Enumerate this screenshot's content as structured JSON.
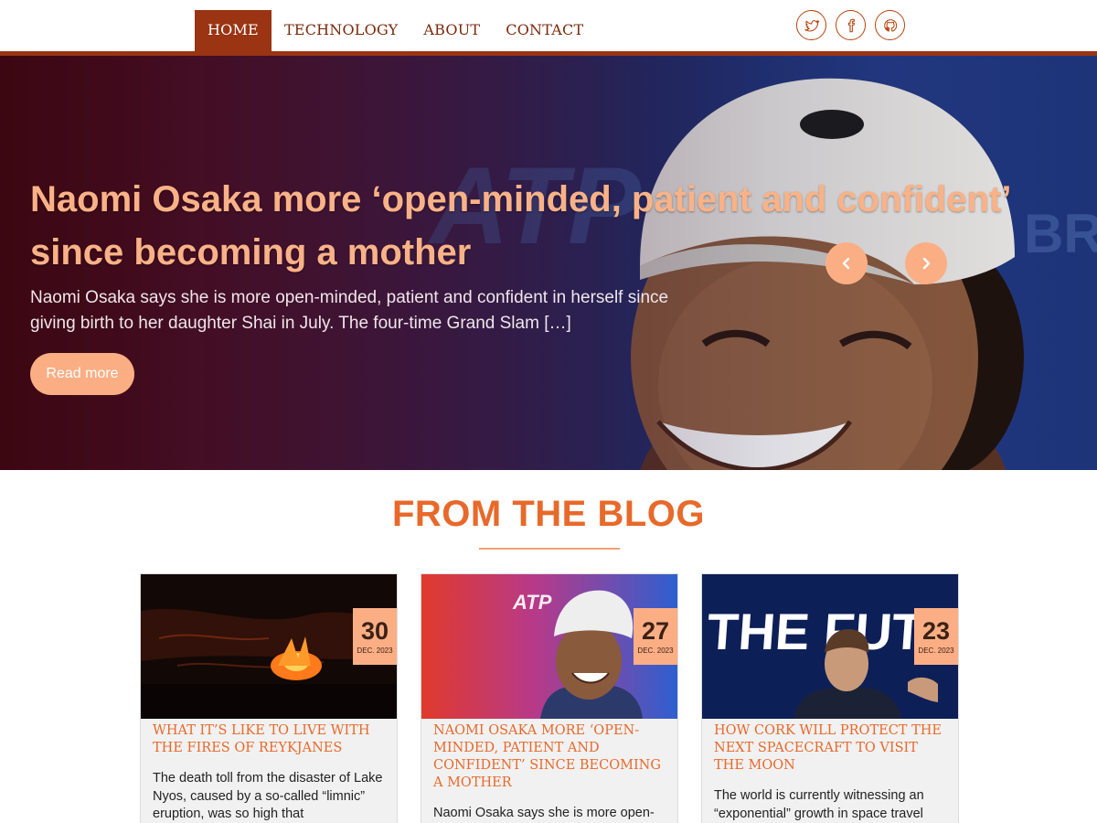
{
  "nav": {
    "items": [
      {
        "label": "HOME",
        "active": true
      },
      {
        "label": "TECHNOLOGY",
        "active": false
      },
      {
        "label": "ABOUT",
        "active": false
      },
      {
        "label": "CONTACT",
        "active": false
      }
    ],
    "social": [
      "twitter-icon",
      "facebook-icon",
      "github-icon"
    ],
    "accent": "#9a3412"
  },
  "hero": {
    "title": "Naomi Osaka more ‘open-minded, patient and confident’ since becoming a mother",
    "excerpt": "Naomi Osaka says she is more open-minded, patient and confident in herself since giving birth to her daughter Shai in July. The four-time Grand Slam […]",
    "button": "Read more",
    "accent": "#fbae84"
  },
  "blog": {
    "heading": "FROM THE BLOG",
    "heading_color": "#e8692a",
    "cards": [
      {
        "day": "30",
        "month": "DEC. 2023",
        "title": "WHAT IT’S LIKE TO LIVE WITH THE FIRES OF REYKJANES",
        "text": "The death toll from the disaster of Lake Nyos, caused by a so-called “limnic” eruption, was so high that"
      },
      {
        "day": "27",
        "month": "DEC. 2023",
        "title": "NAOMI OSAKA MORE ‘OPEN-MINDED, PATIENT AND CONFIDENT’ SINCE BECOMING A MOTHER",
        "text": "Naomi Osaka says she is more open-"
      },
      {
        "day": "23",
        "month": "DEC. 2023",
        "title": "HOW CORK WILL PROTECT THE NEXT SPACECRAFT TO VISIT THE MOON",
        "text": "The world is currently witnessing an “exponential” growth in space travel"
      }
    ]
  }
}
